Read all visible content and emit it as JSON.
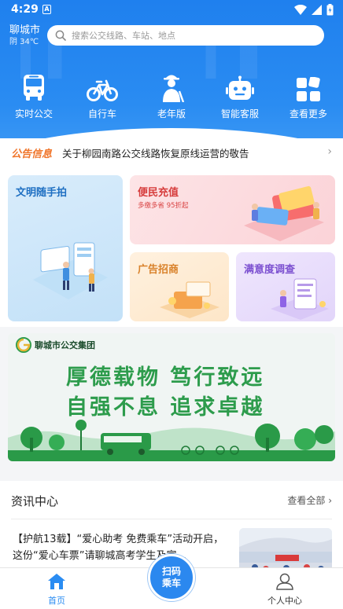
{
  "status": {
    "time": "4:29",
    "notif_icon": "A"
  },
  "location": {
    "city": "聊城市",
    "weather": "阴 34℃"
  },
  "search": {
    "placeholder": "搜索公交线路、车站、地点"
  },
  "quick_actions": [
    {
      "label": "实时公交",
      "icon": "bus-icon"
    },
    {
      "label": "自行车",
      "icon": "bicycle-icon"
    },
    {
      "label": "老年版",
      "icon": "elderly-icon"
    },
    {
      "label": "智能客服",
      "icon": "robot-icon"
    },
    {
      "label": "查看更多",
      "icon": "grid-icon"
    }
  ],
  "notice": {
    "tag": "公告信息",
    "text": "关于柳园南路公交线路恢复原线运营的敬告"
  },
  "cards": {
    "civil_photo": {
      "title": "文明随手拍"
    },
    "recharge": {
      "title": "便民充值",
      "subtitle": "多缴多省 95折起"
    },
    "ads": {
      "title": "广告招商"
    },
    "survey": {
      "title": "满意度调查"
    }
  },
  "banner": {
    "brand": "聊城市公交集团",
    "line1": "厚德载物  笃行致远",
    "line2": "自强不息  追求卓越"
  },
  "news": {
    "title": "资讯中心",
    "more": "查看全部",
    "items": [
      {
        "text": "【护航13载】“爱心助考 免费乘车”活动开启，这份“爱心车票”请聊城高考学生及家…"
      }
    ]
  },
  "bottom_nav": {
    "home": "首页",
    "scan_line1": "扫码",
    "scan_line2": "乘车",
    "profile": "个人中心"
  },
  "colors": {
    "primary": "#2a8cf2",
    "notice": "#f0762c",
    "banner_green": "#2d9c4c"
  }
}
